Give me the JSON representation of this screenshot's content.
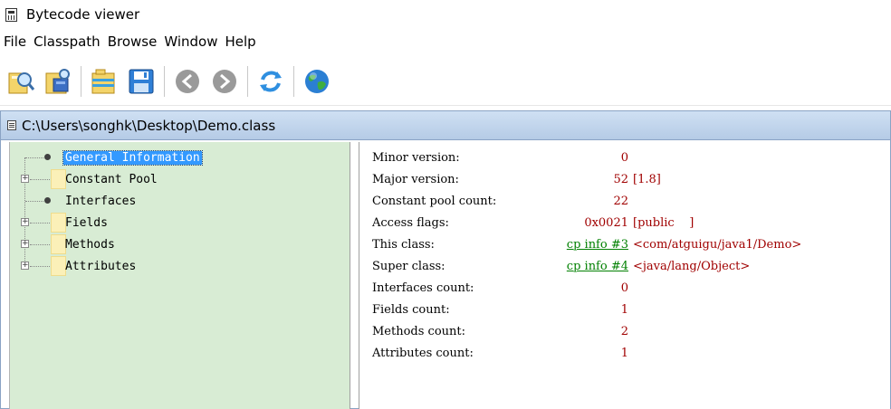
{
  "window": {
    "title": "Bytecode viewer"
  },
  "menu": [
    "File",
    "Classpath",
    "Browse",
    "Window",
    "Help"
  ],
  "toolbar": {
    "buttons": [
      "open-class-icon",
      "open-jar-icon",
      "open-folder-icon",
      "save-icon",
      "back-icon",
      "forward-icon",
      "reload-icon",
      "browser-icon"
    ]
  },
  "frame": {
    "path": "C:\\Users\\songhk\\Desktop\\Demo.class"
  },
  "tree": {
    "items": [
      {
        "label": "General Information",
        "type": "leaf",
        "selected": true
      },
      {
        "label": "Constant Pool",
        "type": "folder",
        "expandable": true
      },
      {
        "label": "Interfaces",
        "type": "leaf"
      },
      {
        "label": "Fields",
        "type": "folder",
        "expandable": true
      },
      {
        "label": "Methods",
        "type": "folder",
        "expandable": true
      },
      {
        "label": "Attributes",
        "type": "folder",
        "expandable": true
      }
    ]
  },
  "details": {
    "rows": [
      {
        "label": "Minor version:",
        "value": "0",
        "extra": ""
      },
      {
        "label": "Major version:",
        "value": "52",
        "extra": "[1.8]"
      },
      {
        "label": "Constant pool count:",
        "value": "22",
        "extra": ""
      },
      {
        "label": "Access flags:",
        "value": "0x0021",
        "extra": "[public    ]"
      },
      {
        "label": "This class:",
        "link": "cp info #3",
        "extra": "<com/atguigu/java1/Demo>"
      },
      {
        "label": "Super class:",
        "link": "cp info #4",
        "extra": "<java/lang/Object>"
      },
      {
        "label": "Interfaces count:",
        "value": "0",
        "extra": ""
      },
      {
        "label": "Fields count:",
        "value": "1",
        "extra": ""
      },
      {
        "label": "Methods count:",
        "value": "2",
        "extra": ""
      },
      {
        "label": "Attributes count:",
        "value": "1",
        "extra": ""
      }
    ]
  },
  "colors": {
    "tree_bg": "#d8ecd4",
    "value_red": "#a00000",
    "link_green": "#008000",
    "selection": "#3399ff",
    "frame_title": "#c3d6ee"
  }
}
